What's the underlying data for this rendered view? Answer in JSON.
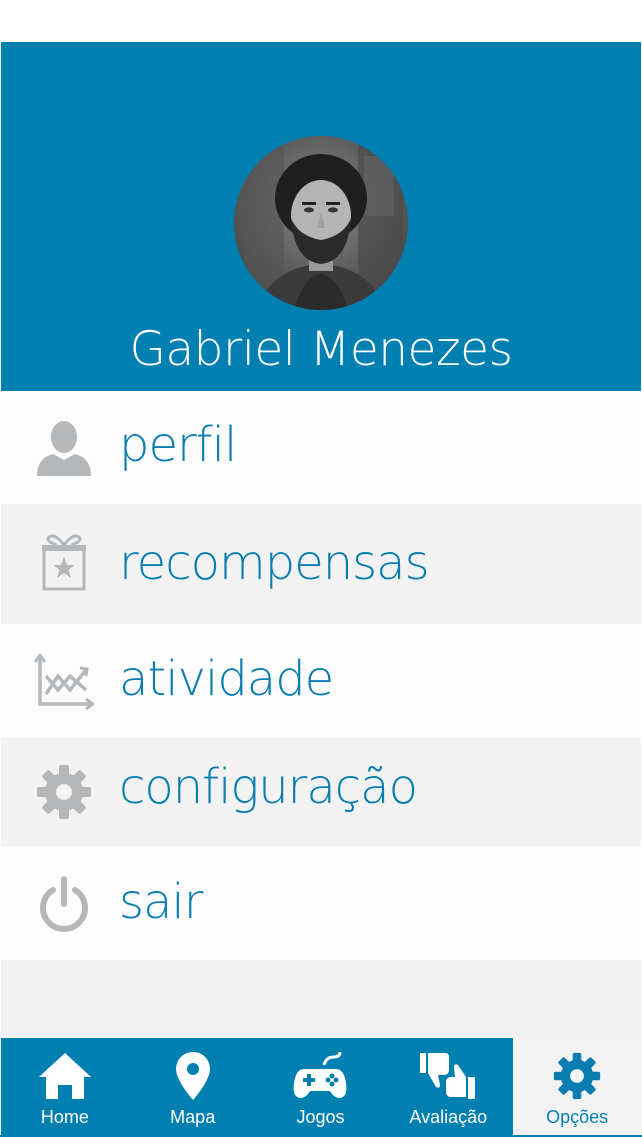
{
  "profile": {
    "name": "Gabriel Menezes"
  },
  "menu": {
    "items": [
      {
        "label": "perfil",
        "icon": "person-icon"
      },
      {
        "label": "recompensas",
        "icon": "gift-star-icon"
      },
      {
        "label": "atividade",
        "icon": "activity-chart-icon"
      },
      {
        "label": "configuração",
        "icon": "gear-icon"
      },
      {
        "label": "sair",
        "icon": "power-icon"
      }
    ]
  },
  "tabbar": {
    "tabs": [
      {
        "label": "Home",
        "icon": "home-icon",
        "active": false
      },
      {
        "label": "Mapa",
        "icon": "map-pin-icon",
        "active": false
      },
      {
        "label": "Jogos",
        "icon": "gamepad-icon",
        "active": false
      },
      {
        "label": "Avaliação",
        "icon": "thumbs-up-down-icon",
        "active": false
      },
      {
        "label": "Opções",
        "icon": "gear-icon",
        "active": true
      }
    ]
  },
  "colors": {
    "brand": "#007fb1",
    "menu_text": "#0a7db0",
    "icon_grey": "#b4b8bb",
    "row_grey": "#f2f2f2"
  }
}
